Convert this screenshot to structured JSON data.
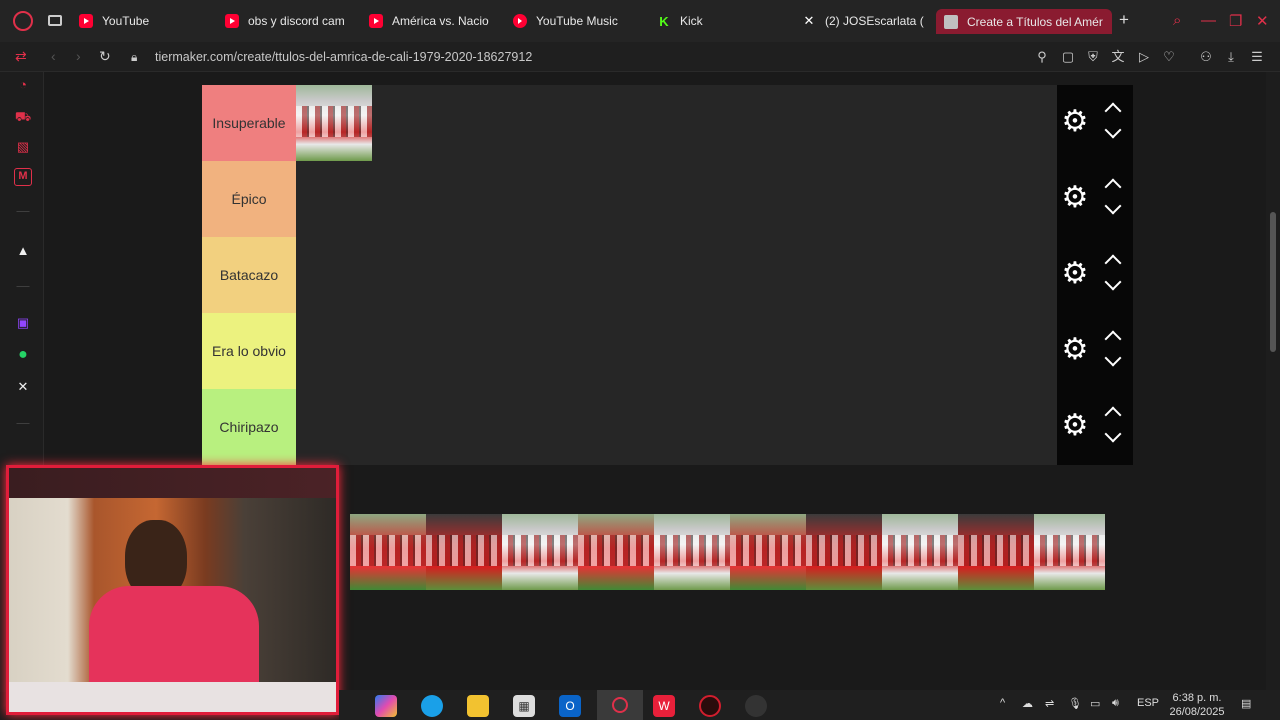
{
  "browser": {
    "tabs": [
      {
        "label": "YouTube",
        "icon": "youtube-icon"
      },
      {
        "label": "obs y discord cam",
        "icon": "youtube-icon"
      },
      {
        "label": "América vs. Nacio",
        "icon": "youtube-icon"
      },
      {
        "label": "YouTube Music",
        "icon": "youtube-music-icon"
      },
      {
        "label": "Kick",
        "icon": "kick-icon"
      },
      {
        "label": "(2) JOSEscarlata (",
        "icon": "x-icon"
      },
      {
        "label": "Create a Títulos del Amér",
        "icon": "tiermaker-icon"
      }
    ],
    "url": "tiermaker.com/create/ttulos-del-amrica-de-cali-1979-2020-18627912",
    "accent": "#e0304a"
  },
  "tiers": [
    {
      "label": "Insuperable",
      "color": "#ef7f7f",
      "items": 1
    },
    {
      "label": "Épico",
      "color": "#f1b27f",
      "items": 0
    },
    {
      "label": "Batacazo",
      "color": "#f2d07f",
      "items": 0
    },
    {
      "label": "Era lo obvio",
      "color": "#ecf27f",
      "items": 0
    },
    {
      "label": "Chiripazo",
      "color": "#b8f07f",
      "items": 0
    }
  ],
  "pool_count": 10,
  "taskbar": {
    "lang": "ESP",
    "time": "6:38 p. m.",
    "date": "26/08/2025"
  }
}
